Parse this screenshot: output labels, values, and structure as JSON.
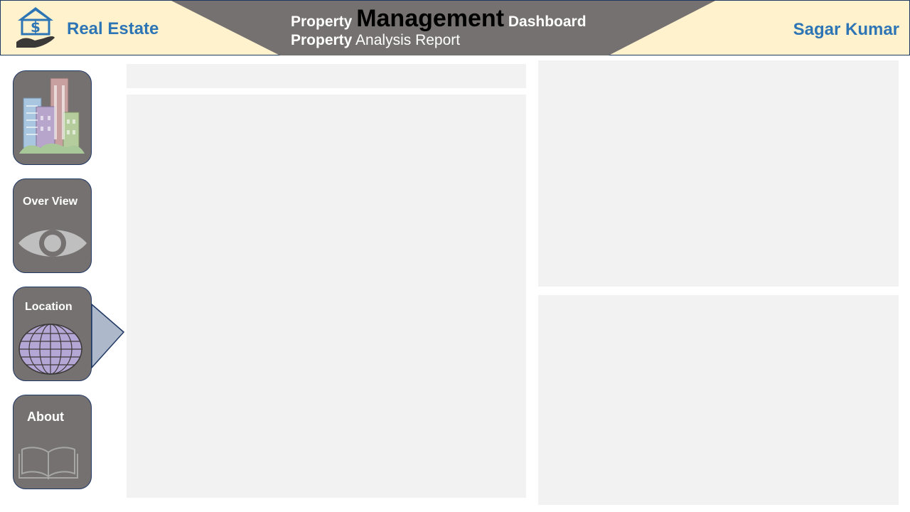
{
  "header": {
    "brand": "Real Estate",
    "title_word1": "Property",
    "title_word2": "Management",
    "title_word3": "Dashboard",
    "subtitle_bold": "Property",
    "subtitle_rest": "Analysis Report",
    "user": "Sagar Kumar",
    "logo_icon": "house-dollar-hand-icon"
  },
  "nav": {
    "home_icon": "city-buildings-icon",
    "overview_label": "Over View",
    "overview_icon": "eye-icon",
    "location_label": "Location",
    "location_icon": "globe-icon",
    "about_label": "About",
    "about_icon": "open-book-icon",
    "active": "Location"
  },
  "colors": {
    "header_bg": "#fff2cc",
    "banner": "#767171",
    "accent_text": "#2e75b6",
    "nav_button": "#767171",
    "panel": "#f2f2f2",
    "pointer": "#adb9ca"
  }
}
